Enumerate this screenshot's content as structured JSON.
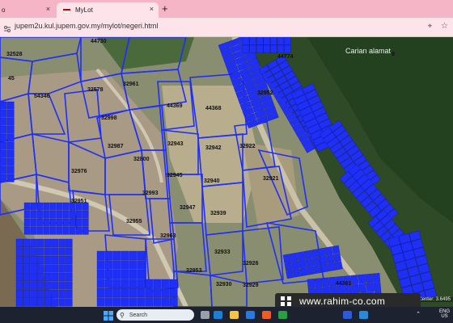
{
  "browser": {
    "tabs": [
      {
        "label": "o",
        "active": false
      },
      {
        "label": "MyLot",
        "active": true
      }
    ],
    "close_glyph": "×",
    "new_tab_glyph": "+",
    "url": "jupem2u.kul.jupem.gov.my/mylot/negeri.html",
    "address_icons": [
      "location-icon",
      "star-icon"
    ]
  },
  "map": {
    "search_label": "Carian alamat",
    "scale_text": "Center: 3.6495",
    "lot_color": "#1f2ff5",
    "lots": [
      {
        "id": "44730"
      },
      {
        "id": "32528"
      },
      {
        "id": "45"
      },
      {
        "id": "32578"
      },
      {
        "id": "54346"
      },
      {
        "id": "32961"
      },
      {
        "id": "44369"
      },
      {
        "id": "44368"
      },
      {
        "id": "32998"
      },
      {
        "id": "32987"
      },
      {
        "id": "32800"
      },
      {
        "id": "32943"
      },
      {
        "id": "32942"
      },
      {
        "id": "32922"
      },
      {
        "id": "32976"
      },
      {
        "id": "32945"
      },
      {
        "id": "32940"
      },
      {
        "id": "32951"
      },
      {
        "id": "32921"
      },
      {
        "id": "32993"
      },
      {
        "id": "32947"
      },
      {
        "id": "32939"
      },
      {
        "id": "32955"
      },
      {
        "id": "32963"
      },
      {
        "id": "32933"
      },
      {
        "id": "32926"
      },
      {
        "id": "32930"
      },
      {
        "id": "32929"
      },
      {
        "id": "44361"
      },
      {
        "id": "32953"
      },
      {
        "id": "44774"
      },
      {
        "id": "32952"
      },
      {
        "id": "9"
      }
    ]
  },
  "watermark": {
    "text": "www.rahim-co.com"
  },
  "taskbar": {
    "search_placeholder": "Search",
    "lang_line1": "ENG",
    "lang_line2": "US"
  }
}
